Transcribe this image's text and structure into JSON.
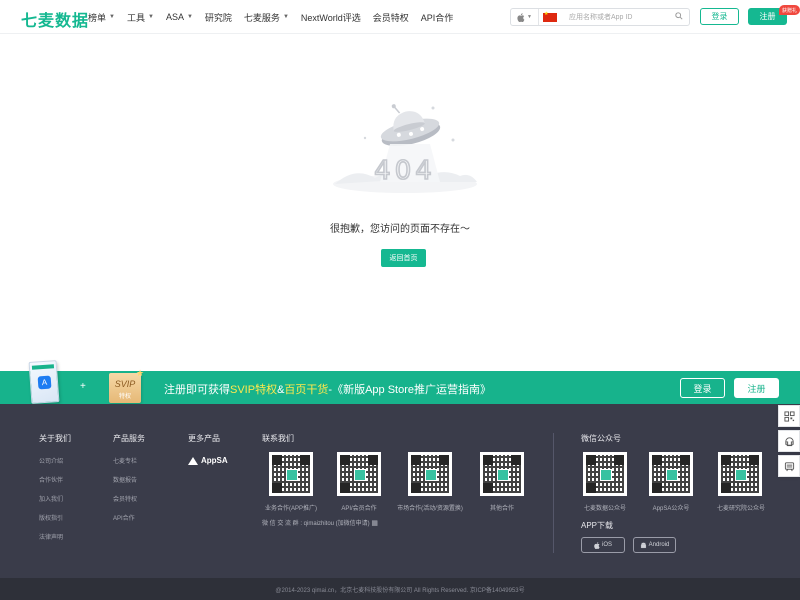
{
  "header": {
    "logo": "七麦数据",
    "nav": [
      {
        "label": "榜单",
        "dropdown": true
      },
      {
        "label": "工具",
        "dropdown": true
      },
      {
        "label": "ASA",
        "dropdown": true
      },
      {
        "label": "研究院",
        "dropdown": false
      },
      {
        "label": "七麦服务",
        "dropdown": true
      },
      {
        "label": "NextWorld评选",
        "dropdown": false
      },
      {
        "label": "会员特权",
        "dropdown": false
      },
      {
        "label": "API合作",
        "dropdown": false
      }
    ],
    "search_placeholder": "应用名称或者App ID",
    "login": "登录",
    "register": "注册",
    "register_badge": "获赠礼"
  },
  "error": {
    "code": "404",
    "message": "很抱歉，您访问的页面不存在～",
    "home_button": "返回首页"
  },
  "promo": {
    "plus": "+",
    "svip_card": "SVIP",
    "svip_sub": "特权",
    "text_before": "注册即可获得",
    "highlight1": "SVIP特权",
    "text_mid": "&",
    "highlight2": "百页干货",
    "text_after": "-《新版App Store推广运营指南》",
    "login": "登录",
    "register": "注册"
  },
  "footer": {
    "about": {
      "title": "关于我们",
      "links": [
        "公司介绍",
        "合作伙伴",
        "加入我们",
        "版权指引",
        "法律声明"
      ]
    },
    "products": {
      "title": "产品服务",
      "links": [
        "七麦专栏",
        "数据报告",
        "会员特权",
        "API合作"
      ]
    },
    "more": {
      "title": "更多产品",
      "appsa": "AppSA"
    },
    "contact": {
      "title": "联系我们",
      "qrs": [
        "业务合作(APP推广)",
        "API/会员合作",
        "市场合作(活动/资源置换)",
        "其他合作"
      ],
      "wechat": "微 信 交 流 群 : qimaizhitou (加微信申请)"
    },
    "wechat_public": {
      "title": "微信公众号",
      "qrs": [
        "七麦数据公众号",
        "AppSA公众号",
        "七麦研究院公众号"
      ]
    },
    "app_download": {
      "title": "APP下载",
      "ios": "iOS",
      "android": "Android"
    },
    "copyright": "@2014-2023 qimai.cn，北京七麦科技股份有限公司 All Rights Reserved. 京ICP备14049953号"
  },
  "colors": {
    "brand": "#15b891",
    "footer_bg": "#3a3c4a"
  }
}
